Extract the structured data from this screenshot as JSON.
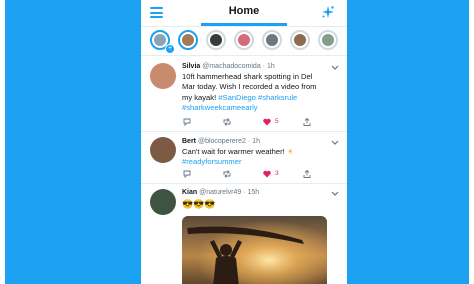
{
  "header": {
    "title": "Home"
  },
  "tweets": [
    {
      "name": "Silvia",
      "handle": "@machadocomida",
      "time": "1h",
      "lines": [
        "10ft hammerhead shark spotting in Del",
        "Mar today. Wish I recorded a video from",
        "my kayak!"
      ],
      "hashtags_line3": "#SanDiego #sharksrule",
      "hashtags_line4": "#sharkweekcameearly",
      "likes": "5"
    },
    {
      "name": "Bert",
      "handle": "@blocoperere2",
      "time": "1h",
      "line1": "Can't wait for warmer weather!",
      "emoji1": "☀",
      "hashtag": "#readyforsummer",
      "likes": "3"
    },
    {
      "name": "Kian",
      "handle": "@naturelvr49",
      "time": "15h",
      "emojis": "😎😎😎"
    }
  ],
  "colors": {
    "accent": "#1da1f2",
    "like": "#e0245e",
    "text": "#14171a",
    "muted": "#657786"
  }
}
